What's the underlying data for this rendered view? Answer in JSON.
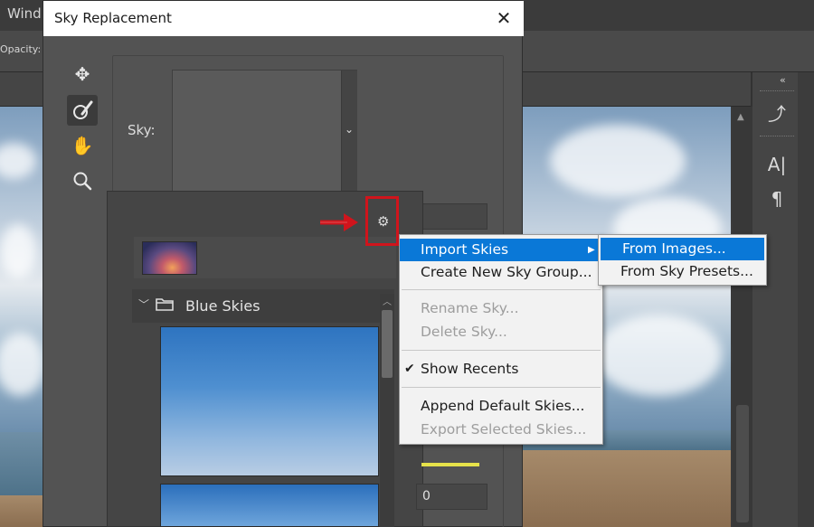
{
  "app": {
    "menu_partial": "Wind",
    "option_partial": "Opacity:"
  },
  "dialog": {
    "title": "Sky Replacement",
    "close_glyph": "✕",
    "sky_label": "Sky:"
  },
  "sky_picker": {
    "group_name": "Blue Skies",
    "field_value": "0"
  },
  "context_menu": {
    "items": [
      {
        "label": "Import Skies",
        "state": "highlighted",
        "has_submenu": true
      },
      {
        "label": "Create New Sky Group...",
        "state": "enabled"
      },
      {
        "label": "Rename Sky...",
        "state": "disabled"
      },
      {
        "label": "Delete Sky...",
        "state": "disabled"
      },
      {
        "label": "Show Recents",
        "state": "checked"
      },
      {
        "label": "Append Default Skies...",
        "state": "enabled"
      },
      {
        "label": "Export Selected Skies...",
        "state": "disabled"
      }
    ]
  },
  "submenu": {
    "items": [
      {
        "label": "From Images...",
        "state": "highlighted"
      },
      {
        "label": "From Sky Presets...",
        "state": "enabled"
      }
    ]
  },
  "colors": {
    "highlight": "#0a78d7",
    "annotation_red": "#d0141c",
    "slider_yellow": "#e6e24a"
  },
  "icons": [
    "move-icon",
    "sky-brush-icon",
    "hand-icon",
    "zoom-icon",
    "gear-icon",
    "folder-icon",
    "history-icon",
    "character-icon",
    "paragraph-icon"
  ]
}
